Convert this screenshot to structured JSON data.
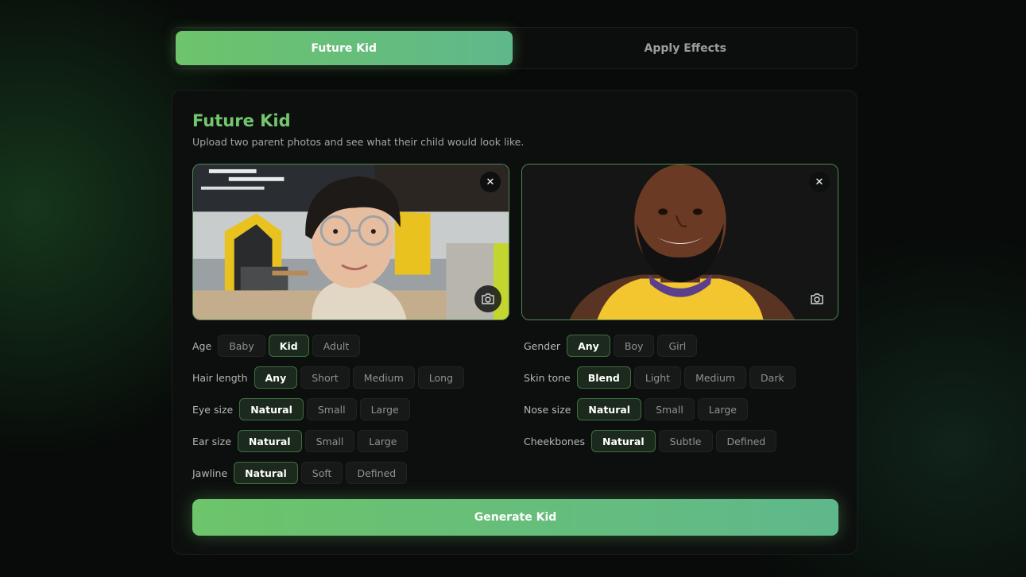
{
  "tabs": [
    {
      "label": "Future Kid",
      "active": true
    },
    {
      "label": "Apply Effects",
      "active": false
    }
  ],
  "card": {
    "title": "Future Kid",
    "subtitle": "Upload two parent photos and see what their child would look like."
  },
  "photos": {
    "close_icon": "close-icon",
    "camera_icon": "camera-icon"
  },
  "options": {
    "age": {
      "label": "Age",
      "choices": [
        "Baby",
        "Kid",
        "Adult"
      ],
      "selected": "Kid"
    },
    "hair_length": {
      "label": "Hair length",
      "choices": [
        "Any",
        "Short",
        "Medium",
        "Long"
      ],
      "selected": "Any"
    },
    "eye_size": {
      "label": "Eye size",
      "choices": [
        "Natural",
        "Small",
        "Large"
      ],
      "selected": "Natural"
    },
    "ear_size": {
      "label": "Ear size",
      "choices": [
        "Natural",
        "Small",
        "Large"
      ],
      "selected": "Natural"
    },
    "jawline": {
      "label": "Jawline",
      "choices": [
        "Natural",
        "Soft",
        "Defined"
      ],
      "selected": "Natural"
    },
    "gender": {
      "label": "Gender",
      "choices": [
        "Any",
        "Boy",
        "Girl"
      ],
      "selected": "Any"
    },
    "skin_tone": {
      "label": "Skin tone",
      "choices": [
        "Blend",
        "Light",
        "Medium",
        "Dark"
      ],
      "selected": "Blend"
    },
    "nose_size": {
      "label": "Nose size",
      "choices": [
        "Natural",
        "Small",
        "Large"
      ],
      "selected": "Natural"
    },
    "cheekbones": {
      "label": "Cheekbones",
      "choices": [
        "Natural",
        "Subtle",
        "Defined"
      ],
      "selected": "Natural"
    }
  },
  "generate_label": "Generate Kid",
  "colors": {
    "accent": "#6dc46a",
    "accent_end": "#5fb88b",
    "background": "#080b09",
    "card": "#0d0f0e"
  }
}
